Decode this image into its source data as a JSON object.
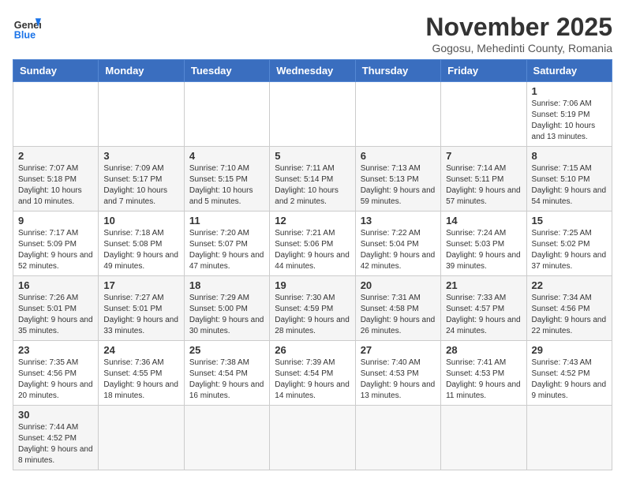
{
  "header": {
    "logo_general": "General",
    "logo_blue": "Blue",
    "month_title": "November 2025",
    "subtitle": "Gogosu, Mehedinti County, Romania"
  },
  "days_of_week": [
    "Sunday",
    "Monday",
    "Tuesday",
    "Wednesday",
    "Thursday",
    "Friday",
    "Saturday"
  ],
  "weeks": [
    [
      {
        "day": "",
        "info": ""
      },
      {
        "day": "",
        "info": ""
      },
      {
        "day": "",
        "info": ""
      },
      {
        "day": "",
        "info": ""
      },
      {
        "day": "",
        "info": ""
      },
      {
        "day": "",
        "info": ""
      },
      {
        "day": "1",
        "info": "Sunrise: 7:06 AM\nSunset: 5:19 PM\nDaylight: 10 hours and 13 minutes."
      }
    ],
    [
      {
        "day": "2",
        "info": "Sunrise: 7:07 AM\nSunset: 5:18 PM\nDaylight: 10 hours and 10 minutes."
      },
      {
        "day": "3",
        "info": "Sunrise: 7:09 AM\nSunset: 5:17 PM\nDaylight: 10 hours and 7 minutes."
      },
      {
        "day": "4",
        "info": "Sunrise: 7:10 AM\nSunset: 5:15 PM\nDaylight: 10 hours and 5 minutes."
      },
      {
        "day": "5",
        "info": "Sunrise: 7:11 AM\nSunset: 5:14 PM\nDaylight: 10 hours and 2 minutes."
      },
      {
        "day": "6",
        "info": "Sunrise: 7:13 AM\nSunset: 5:13 PM\nDaylight: 9 hours and 59 minutes."
      },
      {
        "day": "7",
        "info": "Sunrise: 7:14 AM\nSunset: 5:11 PM\nDaylight: 9 hours and 57 minutes."
      },
      {
        "day": "8",
        "info": "Sunrise: 7:15 AM\nSunset: 5:10 PM\nDaylight: 9 hours and 54 minutes."
      }
    ],
    [
      {
        "day": "9",
        "info": "Sunrise: 7:17 AM\nSunset: 5:09 PM\nDaylight: 9 hours and 52 minutes."
      },
      {
        "day": "10",
        "info": "Sunrise: 7:18 AM\nSunset: 5:08 PM\nDaylight: 9 hours and 49 minutes."
      },
      {
        "day": "11",
        "info": "Sunrise: 7:20 AM\nSunset: 5:07 PM\nDaylight: 9 hours and 47 minutes."
      },
      {
        "day": "12",
        "info": "Sunrise: 7:21 AM\nSunset: 5:06 PM\nDaylight: 9 hours and 44 minutes."
      },
      {
        "day": "13",
        "info": "Sunrise: 7:22 AM\nSunset: 5:04 PM\nDaylight: 9 hours and 42 minutes."
      },
      {
        "day": "14",
        "info": "Sunrise: 7:24 AM\nSunset: 5:03 PM\nDaylight: 9 hours and 39 minutes."
      },
      {
        "day": "15",
        "info": "Sunrise: 7:25 AM\nSunset: 5:02 PM\nDaylight: 9 hours and 37 minutes."
      }
    ],
    [
      {
        "day": "16",
        "info": "Sunrise: 7:26 AM\nSunset: 5:01 PM\nDaylight: 9 hours and 35 minutes."
      },
      {
        "day": "17",
        "info": "Sunrise: 7:27 AM\nSunset: 5:01 PM\nDaylight: 9 hours and 33 minutes."
      },
      {
        "day": "18",
        "info": "Sunrise: 7:29 AM\nSunset: 5:00 PM\nDaylight: 9 hours and 30 minutes."
      },
      {
        "day": "19",
        "info": "Sunrise: 7:30 AM\nSunset: 4:59 PM\nDaylight: 9 hours and 28 minutes."
      },
      {
        "day": "20",
        "info": "Sunrise: 7:31 AM\nSunset: 4:58 PM\nDaylight: 9 hours and 26 minutes."
      },
      {
        "day": "21",
        "info": "Sunrise: 7:33 AM\nSunset: 4:57 PM\nDaylight: 9 hours and 24 minutes."
      },
      {
        "day": "22",
        "info": "Sunrise: 7:34 AM\nSunset: 4:56 PM\nDaylight: 9 hours and 22 minutes."
      }
    ],
    [
      {
        "day": "23",
        "info": "Sunrise: 7:35 AM\nSunset: 4:56 PM\nDaylight: 9 hours and 20 minutes."
      },
      {
        "day": "24",
        "info": "Sunrise: 7:36 AM\nSunset: 4:55 PM\nDaylight: 9 hours and 18 minutes."
      },
      {
        "day": "25",
        "info": "Sunrise: 7:38 AM\nSunset: 4:54 PM\nDaylight: 9 hours and 16 minutes."
      },
      {
        "day": "26",
        "info": "Sunrise: 7:39 AM\nSunset: 4:54 PM\nDaylight: 9 hours and 14 minutes."
      },
      {
        "day": "27",
        "info": "Sunrise: 7:40 AM\nSunset: 4:53 PM\nDaylight: 9 hours and 13 minutes."
      },
      {
        "day": "28",
        "info": "Sunrise: 7:41 AM\nSunset: 4:53 PM\nDaylight: 9 hours and 11 minutes."
      },
      {
        "day": "29",
        "info": "Sunrise: 7:43 AM\nSunset: 4:52 PM\nDaylight: 9 hours and 9 minutes."
      }
    ],
    [
      {
        "day": "30",
        "info": "Sunrise: 7:44 AM\nSunset: 4:52 PM\nDaylight: 9 hours and 8 minutes."
      },
      {
        "day": "",
        "info": ""
      },
      {
        "day": "",
        "info": ""
      },
      {
        "day": "",
        "info": ""
      },
      {
        "day": "",
        "info": ""
      },
      {
        "day": "",
        "info": ""
      },
      {
        "day": "",
        "info": ""
      }
    ]
  ]
}
